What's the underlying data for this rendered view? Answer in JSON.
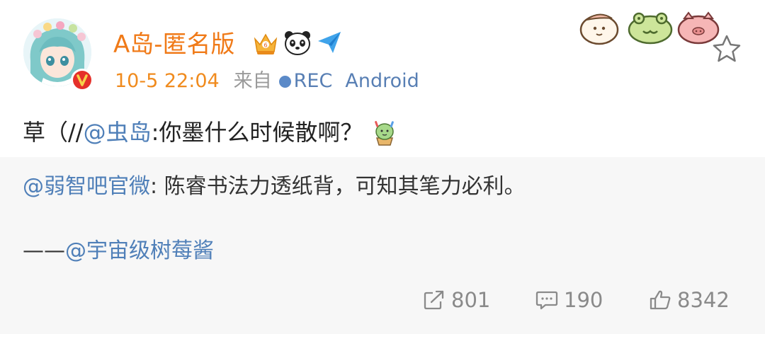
{
  "post": {
    "username": "A岛-匿名版",
    "time": "10-5 22:04",
    "from_label": "来自",
    "client": "REC",
    "client_os": "Android",
    "content_prefix": "草（//",
    "content_mention": "@虫岛",
    "content_text": ":你墨什么时候散啊？"
  },
  "repost": {
    "author_mention": "@弱智吧官微",
    "text": ": 陈睿书法力透纸背，可知其笔力必利。",
    "attribution_dash": "——",
    "attribution_mention": "@宇宙级树莓酱"
  },
  "actions": {
    "repost_count": "801",
    "comment_count": "190",
    "like_count": "8342"
  },
  "colors": {
    "username": "#f07a18",
    "time": "#f08b1e",
    "mention": "#4f7fb8",
    "meta_gray": "#9a9a9a",
    "repost_bg": "#f7f7f7"
  },
  "icons": {
    "crown": "crown-icon",
    "panda": "panda-icon",
    "plane": "paper-plane-icon",
    "verified": "verified-v-icon",
    "star": "star-icon",
    "repost": "share-icon",
    "comment": "comment-icon",
    "like": "thumbs-up-icon"
  }
}
